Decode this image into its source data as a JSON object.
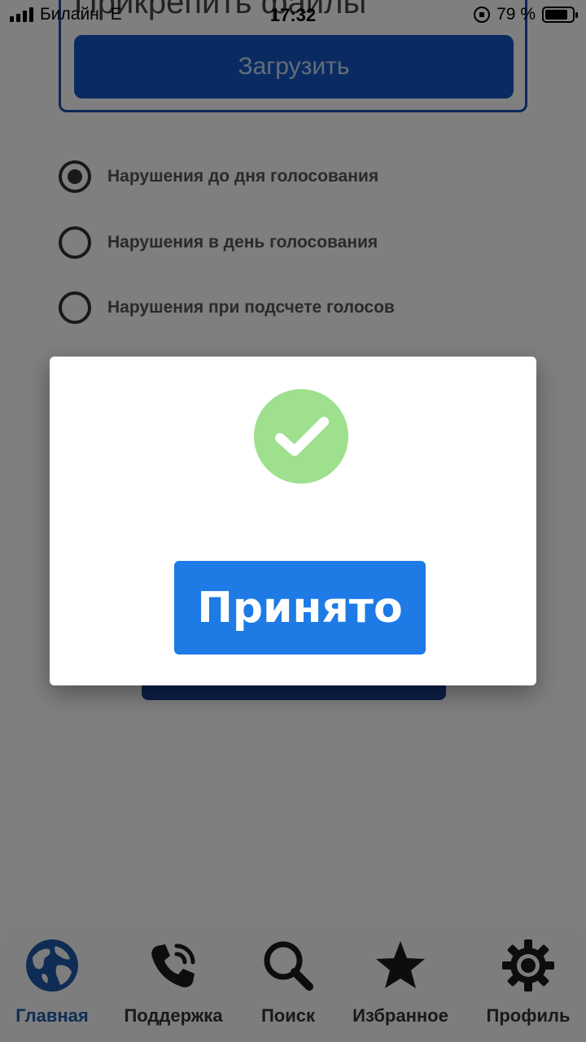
{
  "status_bar": {
    "carrier": "Билайн",
    "network": "E",
    "time": "17:32",
    "battery": "79 %"
  },
  "form": {
    "attach_title": "Прикрепить файлы",
    "upload_label": "Загрузить",
    "options": [
      {
        "label": "Нарушения до дня голосования",
        "selected": true
      },
      {
        "label": "Нарушения в день голосования",
        "selected": false
      },
      {
        "label": "Нарушения при подсчете голосов",
        "selected": false
      }
    ]
  },
  "modal": {
    "icon": "checkmark-icon",
    "icon_color": "#9ee08d",
    "button_label": "Принято",
    "button_color": "#1e7be6"
  },
  "tab_bar": {
    "active_color": "#1e5aa8",
    "items": [
      {
        "label": "Главная",
        "icon": "globe-icon",
        "active": true
      },
      {
        "label": "Поддержка",
        "icon": "phone-icon",
        "active": false
      },
      {
        "label": "Поиск",
        "icon": "search-icon",
        "active": false
      },
      {
        "label": "Избранное",
        "icon": "star-icon",
        "active": false
      },
      {
        "label": "Профиль",
        "icon": "gear-icon",
        "active": false
      }
    ]
  }
}
